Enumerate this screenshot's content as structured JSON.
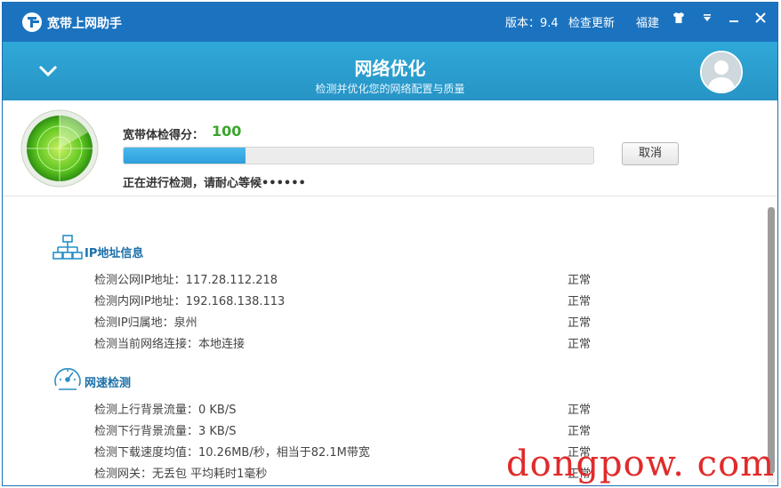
{
  "titlebar": {
    "app_title": "宽带上网助手",
    "version": "版本：9.4",
    "check_update": "检查更新",
    "region": "福建",
    "icons": [
      "shirt-icon",
      "menu-dropdown-icon",
      "minimize-icon",
      "close-icon"
    ]
  },
  "banner": {
    "title": "网络优化",
    "subtitle": "检测并优化您的网络配置与质量"
  },
  "score": {
    "label": "宽带体检得分：",
    "value": "100",
    "progress": 0.26,
    "status": "正在进行检测，请耐心等候••••••",
    "cancel_label": "取消"
  },
  "sections": [
    {
      "title": "IP地址信息",
      "icon": "network-icon",
      "rows": [
        {
          "text": "检测公网IP地址：117.28.112.218",
          "state": "正常"
        },
        {
          "text": "检测内网IP地址：192.168.138.113",
          "state": "正常"
        },
        {
          "text": "检测IP归属地：泉州",
          "state": "正常"
        },
        {
          "text": "检测当前网络连接：本地连接",
          "state": "正常"
        }
      ]
    },
    {
      "title": "网速检测",
      "icon": "speedometer-icon",
      "rows": [
        {
          "text": "检测上行背景流量：0 KB/S",
          "state": "正常"
        },
        {
          "text": "检测下行背景流量：3 KB/S",
          "state": "正常"
        },
        {
          "text": "检测下载速度均值：10.26MB/秒，相当于82.1M带宽",
          "state": "正常"
        },
        {
          "text": "检测网关：无丢包 平均耗时1毫秒",
          "state": "正常"
        }
      ]
    }
  ],
  "watermark": "dongpow. com",
  "colors": {
    "titlebar": "#1b73c0",
    "banner": "#2a9fd0",
    "score": "#3aa52b",
    "progress": "#2d9fdb",
    "section_title": "#1b6fa8",
    "watermark": "#e02b2b"
  }
}
